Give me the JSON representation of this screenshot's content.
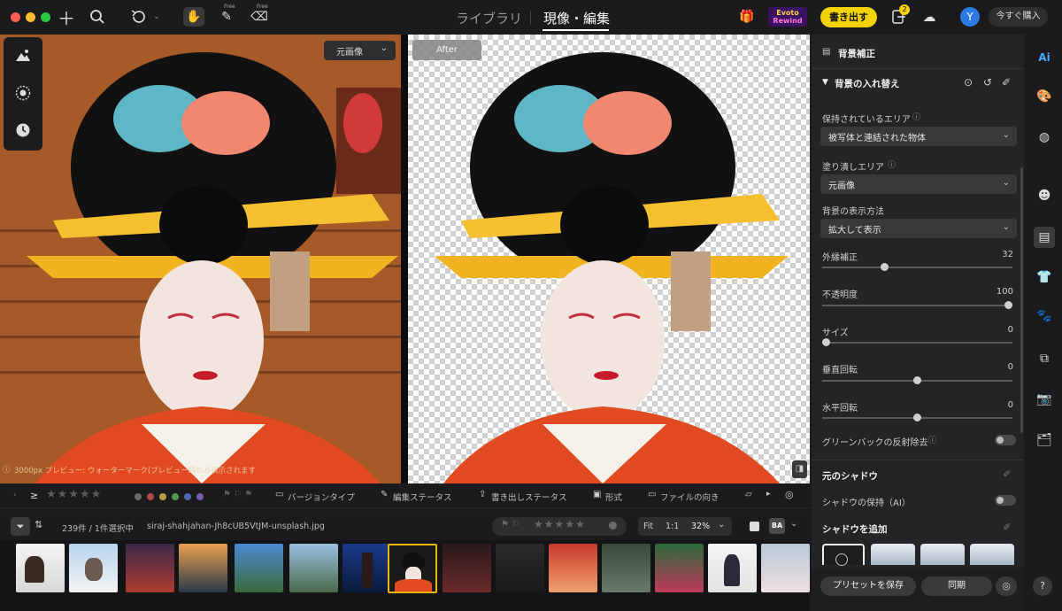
{
  "nav": {
    "tab_library": "ライブラリ",
    "tab_develop": "現像・編集",
    "free1": "Free",
    "free2": "Free"
  },
  "promo": {
    "line1": "Evoto",
    "line2": "Rewind"
  },
  "header": {
    "export_button": "書き出す",
    "notification_count": "2",
    "avatar_letter": "Y",
    "purchase_button": "今すぐ購入"
  },
  "viewer": {
    "before_dropdown": "元画像",
    "after_label": "After",
    "watermark_note": "3000px プレビュー: ウォーターマーク(プレビュー時のみ表示されます"
  },
  "filter_bar": {
    "ge": "≥",
    "version_type": "バージョンタイプ",
    "edit_status": "編集ステータス",
    "export_status": "書き出しステータス",
    "format": "形式",
    "orientation": "ファイルの向き"
  },
  "info_bar": {
    "count": "239件 / 1件選択中",
    "filename": "siraj-shahjahan-Jh8cUB5VtJM-unsplash.jpg",
    "fit": "Fit",
    "one_to_one": "1:1",
    "zoom": "32%",
    "ba": "BA"
  },
  "panel": {
    "section_title": "背景補正",
    "subsection": "背景の入れ替え",
    "preserve_area_label": "保持されているエリア",
    "preserve_area_value": "被写体と連結された物体",
    "fill_area_label": "塗り潰しエリア",
    "fill_area_value": "元画像",
    "display_method_label": "背景の表示方法",
    "display_method_value": "拡大して表示",
    "sliders": [
      {
        "label": "外縁補正",
        "value": "32",
        "fraction": 0.32
      },
      {
        "label": "不透明度",
        "value": "100",
        "fraction": 1.0
      },
      {
        "label": "サイズ",
        "value": "0",
        "fraction": 0.0
      },
      {
        "label": "垂直回転",
        "value": "0",
        "fraction": 0.5
      },
      {
        "label": "水平回転",
        "value": "0",
        "fraction": 0.5
      }
    ],
    "greenback_label": "グリーンバックの反射除去",
    "orig_shadow_title": "元のシャドウ",
    "keep_shadow_label": "シャドウの保持（AI）",
    "add_shadow_title": "シャドウを追加",
    "save_preset": "プリセットを保存",
    "sync": "同期"
  },
  "colors": {
    "accent_yellow": "#f5d300",
    "avatar_blue": "#2c7be5",
    "selected_border": "#e6b800"
  }
}
